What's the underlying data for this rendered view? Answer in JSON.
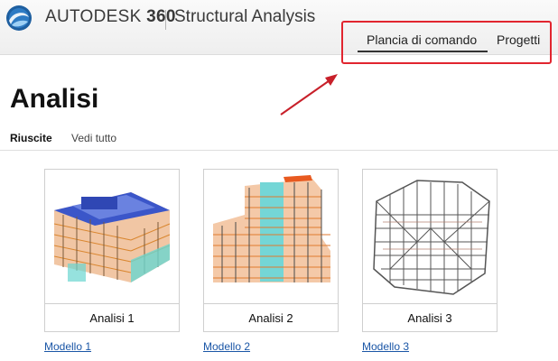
{
  "header": {
    "brand_name": "AUTODESK",
    "brand_version": "360",
    "product": "Structural Analysis",
    "logo_icon": "autodesk-360-logo-icon"
  },
  "nav": {
    "items": [
      {
        "label": "Plancia di comando",
        "active": true
      },
      {
        "label": "Progetti",
        "active": false
      }
    ]
  },
  "page": {
    "title": "Analisi",
    "filters": {
      "active": "Riuscite",
      "all": "Vedi tutto"
    }
  },
  "analyses": [
    {
      "name": "Analisi 1",
      "model_link": "Modello 1",
      "thumbnail_icon": "structural-model-thumbnail-icon"
    },
    {
      "name": "Analisi 2",
      "model_link": "Modello 2",
      "thumbnail_icon": "structural-model-thumbnail-icon"
    },
    {
      "name": "Analisi 3",
      "model_link": "Modello 3",
      "thumbnail_icon": "structural-model-thumbnail-icon"
    }
  ],
  "colors": {
    "callout": "#e1252f",
    "link": "#1a56a6",
    "nav_underline": "#333333"
  }
}
